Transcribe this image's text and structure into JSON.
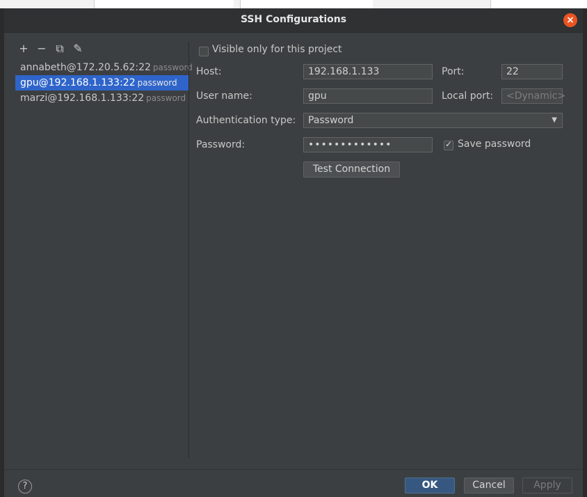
{
  "dialog": {
    "title": "SSH Configurations"
  },
  "toolbar": {
    "add": "+",
    "remove": "−",
    "copy": "⧉",
    "edit": "✎"
  },
  "configs": [
    {
      "name": "annabeth@172.20.5.62:22",
      "auth": "password",
      "selected": false
    },
    {
      "name": "gpu@192.168.1.133:22",
      "auth": "password",
      "selected": true
    },
    {
      "name": "marzi@192.168.1.133:22",
      "auth": "password",
      "selected": false
    }
  ],
  "form": {
    "visible_only_label": "Visible only for this project",
    "host_label": "Host:",
    "host_value": "192.168.1.133",
    "port_label": "Port:",
    "port_value": "22",
    "user_label": "User name:",
    "user_value": "gpu",
    "local_port_label": "Local port:",
    "local_port_placeholder": "<Dynamic>",
    "auth_label": "Authentication type:",
    "auth_value": "Password",
    "password_label": "Password:",
    "password_value": "•••••••••••••",
    "save_password_label": "Save password",
    "test_button": "Test Connection"
  },
  "footer": {
    "help": "?",
    "ok": "OK",
    "cancel": "Cancel",
    "apply": "Apply"
  },
  "colors": {
    "selection": "#2f65ca",
    "close": "#e95420",
    "ok": "#365880"
  }
}
